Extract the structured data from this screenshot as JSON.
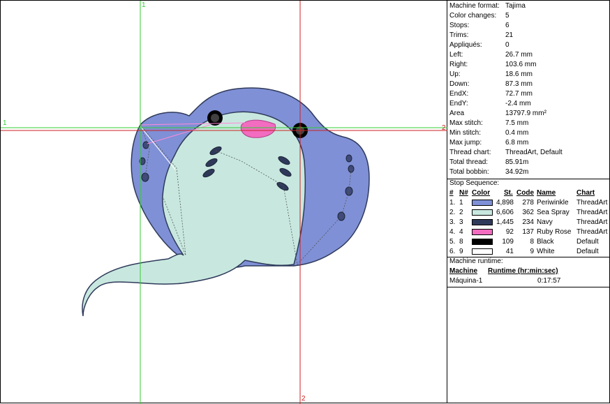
{
  "guides": {
    "vertical_1": "1",
    "vertical_2": "2",
    "horizontal_1": "1",
    "horizontal_2": "2"
  },
  "summary": [
    {
      "label": "Machine format:",
      "value": "Tajima"
    },
    {
      "label": "Color changes:",
      "value": "5"
    },
    {
      "label": "Stops:",
      "value": "6"
    },
    {
      "label": "Trims:",
      "value": "21"
    },
    {
      "label": "Appliqués:",
      "value": "0"
    },
    {
      "label": "Left:",
      "value": "26.7 mm"
    },
    {
      "label": "Right:",
      "value": "103.6 mm"
    },
    {
      "label": "Up:",
      "value": "18.6 mm"
    },
    {
      "label": "Down:",
      "value": "87.3 mm"
    },
    {
      "label": "EndX:",
      "value": "72.7 mm"
    },
    {
      "label": "EndY:",
      "value": "-2.4 mm"
    },
    {
      "label": "Area",
      "value": "13797.9 mm²"
    },
    {
      "label": "Max stitch:",
      "value": "7.5 mm"
    },
    {
      "label": "Min stitch:",
      "value": "0.4 mm"
    },
    {
      "label": "Max jump:",
      "value": "6.8 mm"
    },
    {
      "label": "Thread chart:",
      "value": "ThreadArt, Default"
    },
    {
      "label": "Total thread:",
      "value": "85.91m"
    },
    {
      "label": "Total bobbin:",
      "value": "34.92m"
    }
  ],
  "stop_sequence": {
    "title": "Stop Sequence:",
    "headers": {
      "index": "#",
      "needle": "N#",
      "color": "Color",
      "stitches": "St.",
      "code": "Code",
      "name": "Name",
      "chart": "Chart"
    },
    "rows": [
      {
        "index": "1.",
        "needle": "1",
        "color": "#7f90d6",
        "stitches": "4,898",
        "code": "278",
        "name": "Periwinkle",
        "chart": "ThreadArt"
      },
      {
        "index": "2.",
        "needle": "2",
        "color": "#c8e8df",
        "stitches": "6,606",
        "code": "362",
        "name": "Sea Spray",
        "chart": "ThreadArt"
      },
      {
        "index": "3.",
        "needle": "3",
        "color": "#2f3a5a",
        "stitches": "1,445",
        "code": "234",
        "name": "Navy",
        "chart": "ThreadArt"
      },
      {
        "index": "4.",
        "needle": "4",
        "color": "#f26cc0",
        "stitches": "92",
        "code": "137",
        "name": "Ruby Rose",
        "chart": "ThreadArt"
      },
      {
        "index": "5.",
        "needle": "8",
        "color": "#000000",
        "stitches": "109",
        "code": "8",
        "name": "Black",
        "chart": "Default"
      },
      {
        "index": "6.",
        "needle": "9",
        "color": "#ffffff",
        "stitches": "41",
        "code": "9",
        "name": "White",
        "chart": "Default"
      }
    ]
  },
  "runtime": {
    "title": "Machine runtime:",
    "headers": {
      "machine": "Machine",
      "runtime": "Runtime (hr:min:sec)"
    },
    "rows": [
      {
        "machine": "Máquina-1",
        "runtime": "0:17:57"
      }
    ]
  },
  "design": {
    "name": "stingray-embroidery",
    "body_color": "#7f90d6",
    "belly_color": "#c8e8df",
    "outline_color": "#2f3a5a",
    "mouth_color": "#f26cc0",
    "eye_color": "#000000",
    "guide_color_green": "#33cc33",
    "guide_color_red": "#cc2222"
  }
}
